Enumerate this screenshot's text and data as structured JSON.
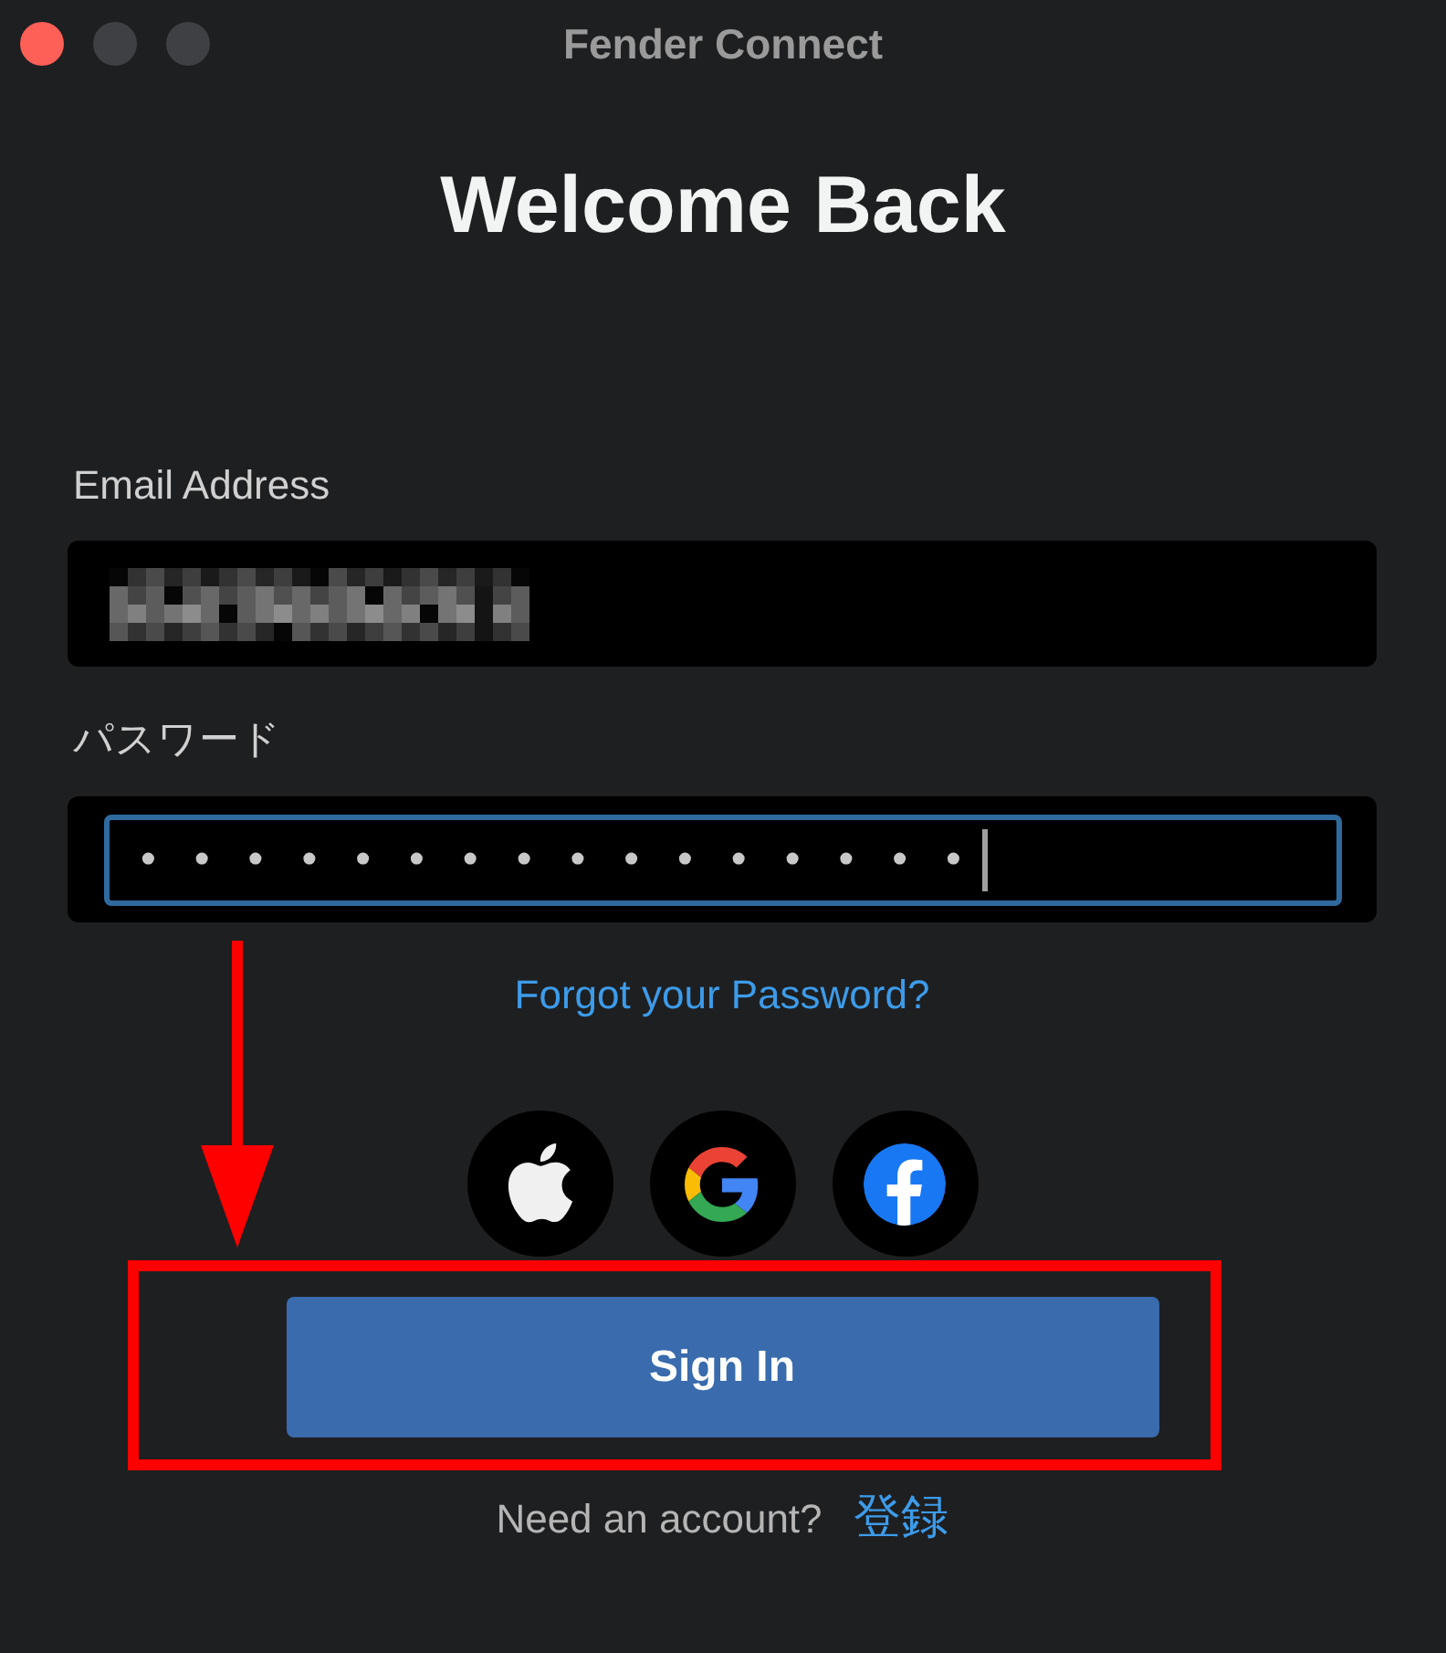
{
  "window": {
    "title": "Fender Connect"
  },
  "heading": "Welcome Back",
  "email_field": {
    "label": "Email Address",
    "redacted": true,
    "focused": false
  },
  "password_field": {
    "label": "パスワード",
    "value": "••••••••••••••••",
    "focused": true
  },
  "forgot_link": "Forgot your Password?",
  "social_buttons": [
    {
      "kind": "apple"
    },
    {
      "kind": "google"
    },
    {
      "kind": "facebook"
    }
  ],
  "sign_in_button": "Sign In",
  "signup": {
    "prompt": "Need an account?",
    "link": "登録"
  },
  "annotations": {
    "arrow": true,
    "highlight_box": true
  }
}
